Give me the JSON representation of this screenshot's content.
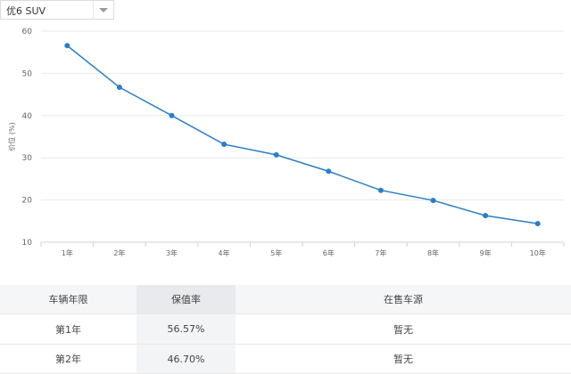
{
  "selector": {
    "selected": "优6 SUV"
  },
  "chart_data": {
    "type": "line",
    "ylabel": "价位 (%)",
    "ylim": [
      10,
      60
    ],
    "yticks": [
      10,
      20,
      30,
      40,
      50,
      60
    ],
    "categories": [
      "1年",
      "2年",
      "3年",
      "4年",
      "5年",
      "6年",
      "7年",
      "8年",
      "9年",
      "10年"
    ],
    "series": [
      {
        "values": [
          56.57,
          46.7,
          40.0,
          33.2,
          30.7,
          26.8,
          22.3,
          19.9,
          16.3,
          14.4
        ]
      }
    ],
    "grid": true,
    "color": "#2a7ec8"
  },
  "table": {
    "headers": [
      "车辆年限",
      "保值率",
      "在售车源"
    ],
    "rows": [
      [
        "第1年",
        "56.57%",
        "暂无"
      ],
      [
        "第2年",
        "46.70%",
        "暂无"
      ]
    ]
  }
}
